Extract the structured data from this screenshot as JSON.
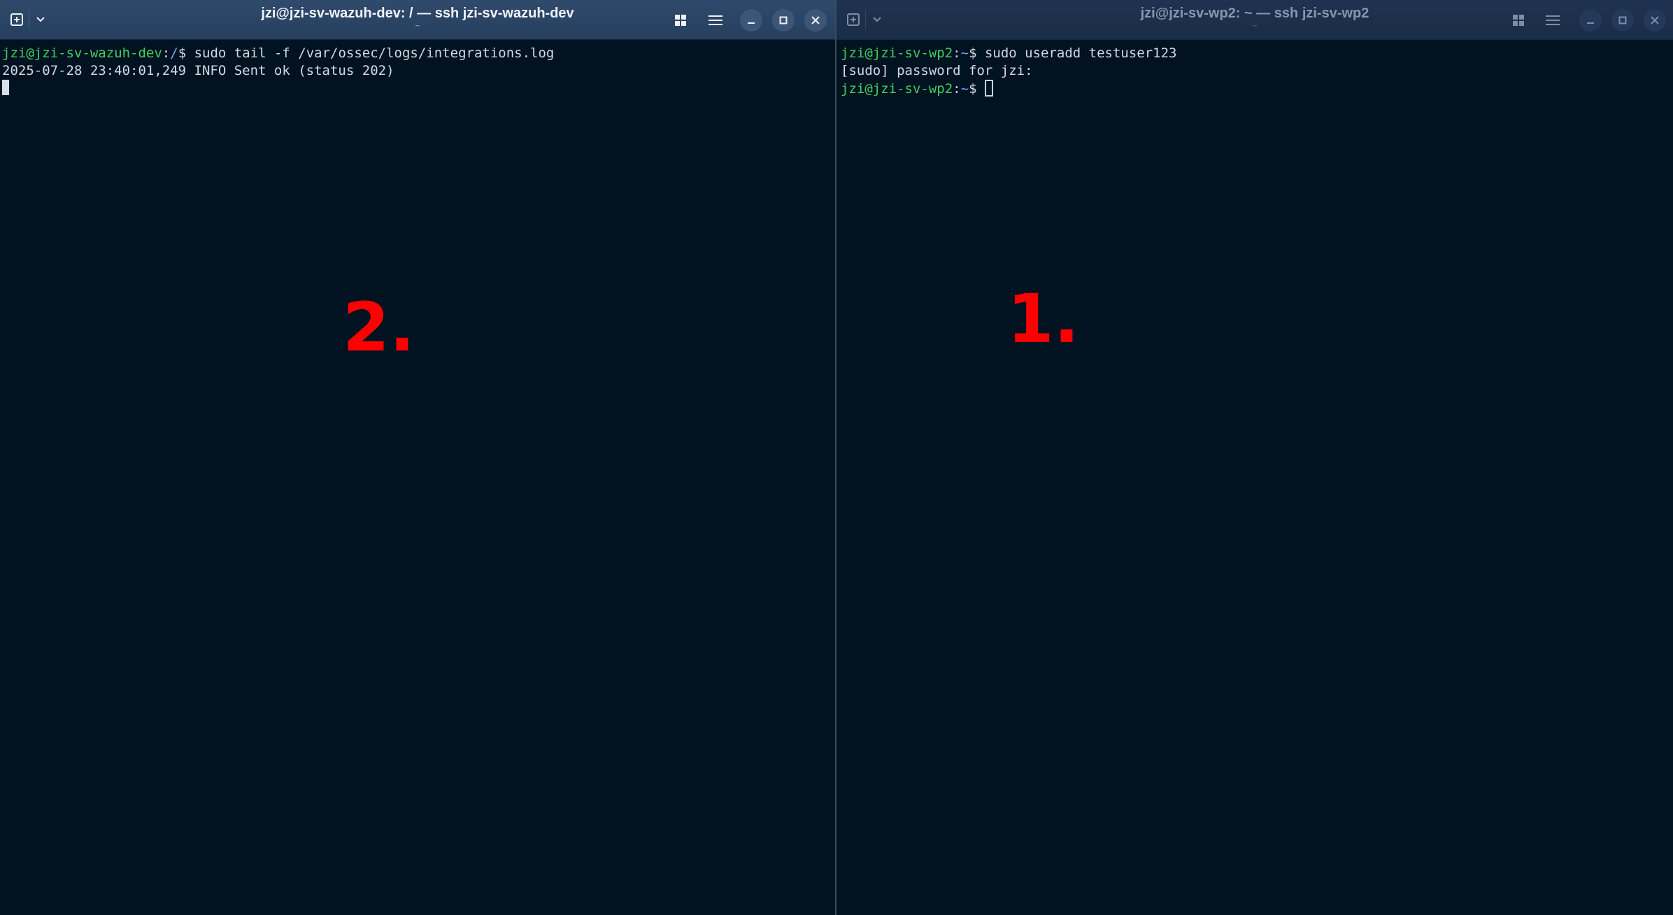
{
  "windows": {
    "left": {
      "title": "jzi@jzi-sv-wazuh-dev: / — ssh jzi-sv-wazuh-dev",
      "subtitle": "~",
      "lines": [
        {
          "user": "jzi@jzi-sv-wazuh-dev",
          "sep": ":",
          "path": "/",
          "symbol": "$ ",
          "command": "sudo tail -f /var/ossec/logs/integrations.log"
        },
        {
          "text": "2025-07-28 23:40:01,249 INFO Sent ok (status 202)"
        }
      ],
      "marker": "2."
    },
    "right": {
      "title": "jzi@jzi-sv-wp2: ~ — ssh jzi-sv-wp2",
      "subtitle": "~",
      "lines": [
        {
          "user": "jzi@jzi-sv-wp2",
          "sep": ":",
          "path": "~",
          "symbol": "$ ",
          "command": "sudo useradd testuser123"
        },
        {
          "text": "[sudo] password for jzi:"
        },
        {
          "user": "jzi@jzi-sv-wp2",
          "sep": ":",
          "path": "~",
          "symbol": "$ ",
          "command": ""
        }
      ],
      "marker": "1."
    }
  },
  "icons": {
    "new_tab": "plus-square-icon",
    "tab_menu": "chevron-down-icon",
    "split_view": "grid-icon",
    "menu": "hamburger-menu-icon",
    "minimize": "minimize-icon",
    "maximize": "maximize-icon",
    "close": "close-icon"
  },
  "colors": {
    "terminal_bg": "#011221",
    "prompt_user": "#3fd15f",
    "prompt_path": "#6aa9ff",
    "marker": "#ff0000"
  }
}
